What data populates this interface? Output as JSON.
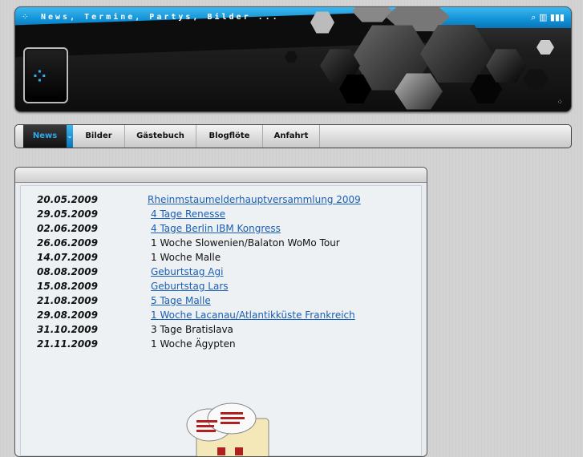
{
  "header": {
    "tagline": "News, Termine, Partys, Bilder ..."
  },
  "nav": {
    "items": [
      {
        "label": "News",
        "active": true
      },
      {
        "label": "Bilder"
      },
      {
        "label": "Gästebuch"
      },
      {
        "label": "Blogflöte"
      },
      {
        "label": "Anfahrt"
      }
    ]
  },
  "events": [
    {
      "date": "20.05.2009",
      "title": "Rheinmstaumelderhauptversammlung 2009",
      "link": true
    },
    {
      "date": "29.05.2009",
      "title": "4 Tage Renesse",
      "link": true
    },
    {
      "date": "02.06.2009",
      "title": "4 Tage Berlin IBM Kongress",
      "link": true
    },
    {
      "date": "26.06.2009",
      "title": "1 Woche Slowenien/Balaton WoMo Tour",
      "link": false
    },
    {
      "date": "14.07.2009",
      "title": "1 Woche Malle",
      "link": false
    },
    {
      "date": "08.08.2009",
      "title": "Geburtstag Agi",
      "link": true
    },
    {
      "date": "15.08.2009",
      "title": "Geburtstag Lars",
      "link": true
    },
    {
      "date": "21.08.2009",
      "title": "5 Tage Malle",
      "link": true
    },
    {
      "date": "29.08.2009",
      "title": "1 Woche Lacanau/Atlantikküste Frankreich",
      "link": true
    },
    {
      "date": "31.10.2009",
      "title": "3 Tage Bratislava",
      "link": false
    },
    {
      "date": "21.11.2009",
      "title": "1 Woche Ägypten",
      "link": false
    }
  ],
  "colors": {
    "accent_blue": "#1191d6",
    "link_blue": "#1a5fb4",
    "header_dark": "#0d0d0d"
  }
}
